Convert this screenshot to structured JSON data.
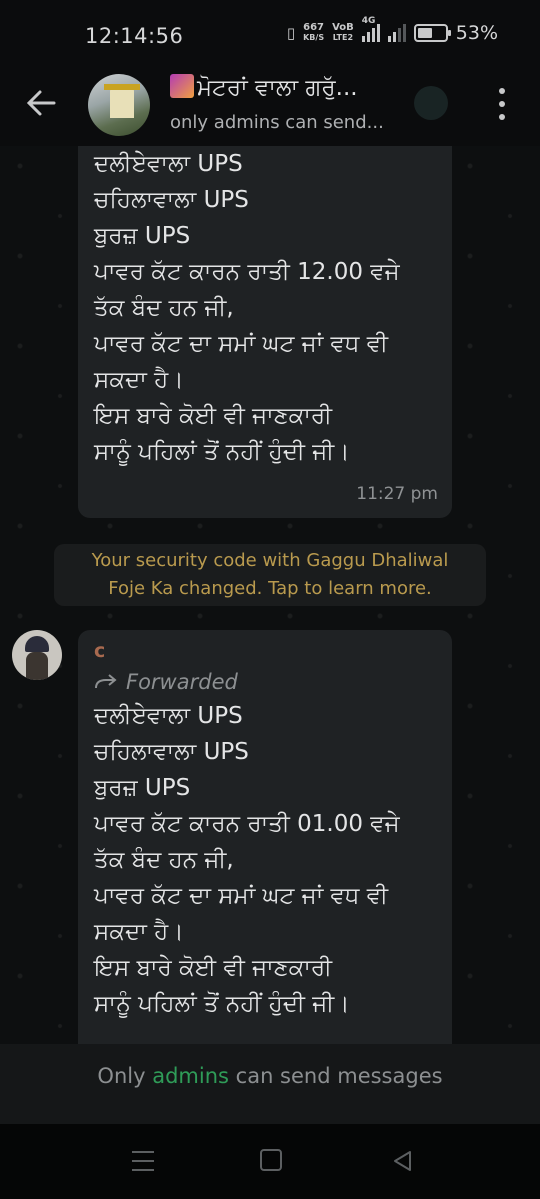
{
  "status_bar": {
    "time": "12:14:56",
    "net_speed": "667",
    "net_unit": "KB/S",
    "volte_top": "VoB",
    "volte_bottom": "LTE2",
    "network_type": "4G",
    "battery_level": 0.53,
    "battery_percent": "53%"
  },
  "header": {
    "group_name": "ਮੋਟਰਾਂ ਵਾਲਾ ਗਰੁੱ...",
    "subtitle": "only admins can send..."
  },
  "messages": [
    {
      "lines": [
        "ਦਲੀਏਵਾਲਾ UPS",
        "ਚਹਿਲਾਵਾਲਾ UPS",
        "ਬੁਰਜ਼ UPS",
        "ਪਾਵਰ ਕੱਟ ਕਾਰਨ ਰਾਤੀ 12.00 ਵਜੇ",
        "ਤੱਕ ਬੰਦ ਹਨ ਜੀ,",
        "ਪਾਵਰ ਕੱਟ ਦਾ ਸਮਾਂ ਘਟ ਜਾਂ ਵਧ ਵੀ",
        "ਸਕਦਾ ਹੈ।",
        "ਇਸ ਬਾਰੇ ਕੋਈ ਵੀ ਜਾਣਕਾਰੀ",
        "ਸਾਨੂੰ ਪਹਿਲਾਂ ਤੋਂ ਨਹੀਂ ਹੁੰਦੀ ਜੀ।"
      ],
      "time": "11:27 pm"
    },
    {
      "sender": "c",
      "forwarded_label": "Forwarded",
      "lines": [
        "ਦਲੀਏਵਾਲਾ UPS",
        "ਚਹਿਲਾਵਾਲਾ UPS",
        "ਬੁਰਜ਼ UPS",
        "ਪਾਵਰ ਕੱਟ ਕਾਰਨ ਰਾਤੀ 01.00 ਵਜੇ",
        "ਤੱਕ ਬੰਦ ਹਨ ਜੀ,",
        "ਪਾਵਰ ਕੱਟ ਦਾ ਸਮਾਂ ਘਟ ਜਾਂ ਵਧ ਵੀ",
        "ਸਕਦਾ ਹੈ।",
        "ਇਸ ਬਾਰੇ ਕੋਈ ਵੀ ਜਾਣਕਾਰੀ",
        "ਸਾਨੂੰ ਪਹਿਲਾਂ ਤੋਂ ਨਹੀਂ ਹੁੰਦੀ ਜੀ।"
      ]
    }
  ],
  "system_notice": {
    "line1": "Your security code with Gaggu Dhaliwal",
    "line2": "Foje Ka changed. Tap to learn more."
  },
  "footer": {
    "prefix": "Only",
    "link": "admins",
    "suffix": "can send messages"
  },
  "colors": {
    "background": "#0b0c0d",
    "bubble": "#1f2224",
    "notice_text": "#b99a4e",
    "admins_link": "#2f9c58",
    "sender_name": "#a86a4f"
  }
}
